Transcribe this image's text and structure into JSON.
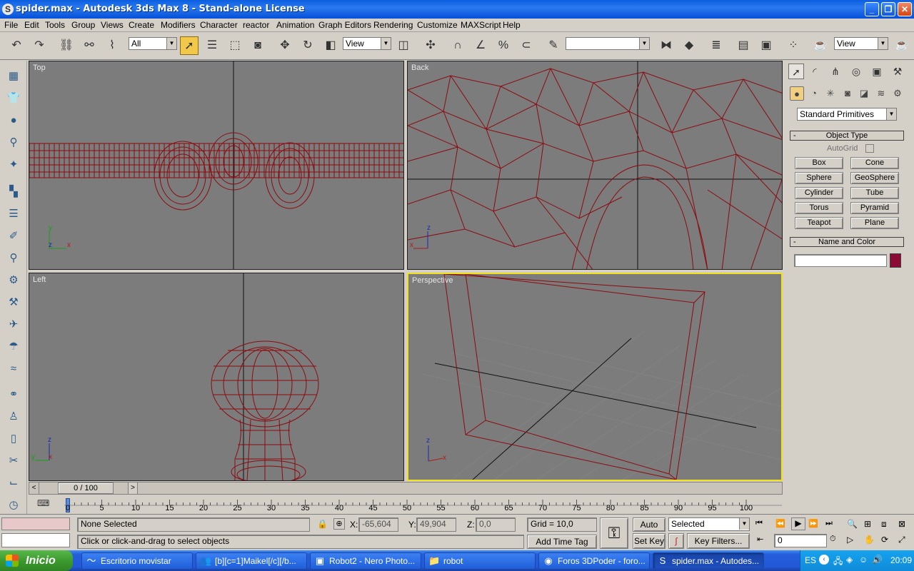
{
  "window": {
    "title": "spider.max - Autodesk 3ds Max 8  - Stand-alone License"
  },
  "menu": [
    "File",
    "Edit",
    "Tools",
    "Group",
    "Views",
    "Create",
    "Modifiers",
    "Character",
    "reactor",
    "Animation",
    "Graph Editors",
    "Rendering",
    "Customize",
    "MAXScript",
    "Help"
  ],
  "toolbar": {
    "selection_filter": "All",
    "ref_coord": "View",
    "named_selection": "",
    "render_view": "View"
  },
  "viewports": {
    "top": "Top",
    "back": "Back",
    "left": "Left",
    "perspective": "Perspective",
    "axes": {
      "x": "x",
      "y": "y",
      "z": "z"
    }
  },
  "command_panel": {
    "category": "Standard Primitives",
    "object_type_header": "Object Type",
    "autogrid_label": "AutoGrid",
    "buttons": [
      "Box",
      "Cone",
      "Sphere",
      "GeoSphere",
      "Cylinder",
      "Tube",
      "Torus",
      "Pyramid",
      "Teapot",
      "Plane"
    ],
    "name_color_header": "Name and Color",
    "name_value": "",
    "color": "#8c0b36"
  },
  "timeline": {
    "position": "0 / 100",
    "ticks": [
      "0",
      "5",
      "10",
      "15",
      "20",
      "25",
      "30",
      "35",
      "40",
      "45",
      "50",
      "55",
      "60",
      "65",
      "70",
      "75",
      "80",
      "85",
      "90",
      "95",
      "100"
    ]
  },
  "status": {
    "selection": "None Selected",
    "prompt": "Click or click-and-drag to select objects",
    "x_label": "X:",
    "x_value": "-65,604",
    "y_label": "Y:",
    "y_value": "49,904",
    "z_label": "Z:",
    "z_value": "0,0",
    "grid": "Grid = 10,0",
    "add_time_tag": "Add Time Tag",
    "auto_key": "Auto Key",
    "set_key": "Set Key",
    "key_mode": "Selected",
    "key_filters": "Key Filters...",
    "frame": "0"
  },
  "taskbar": {
    "start": "Inicio",
    "tasks": [
      "Escritorio movistar",
      "[b][c=1]Maikel[/c][/b...",
      "Robot2 - Nero Photo...",
      "robot",
      "Foros 3DPoder - foro...",
      "spider.max - Autodes..."
    ],
    "lang": "ES",
    "clock": "20:09"
  },
  "colors": {
    "wire": "#8b0b10",
    "viewport_bg": "#7c7c7c",
    "active_border": "#f0e020"
  }
}
